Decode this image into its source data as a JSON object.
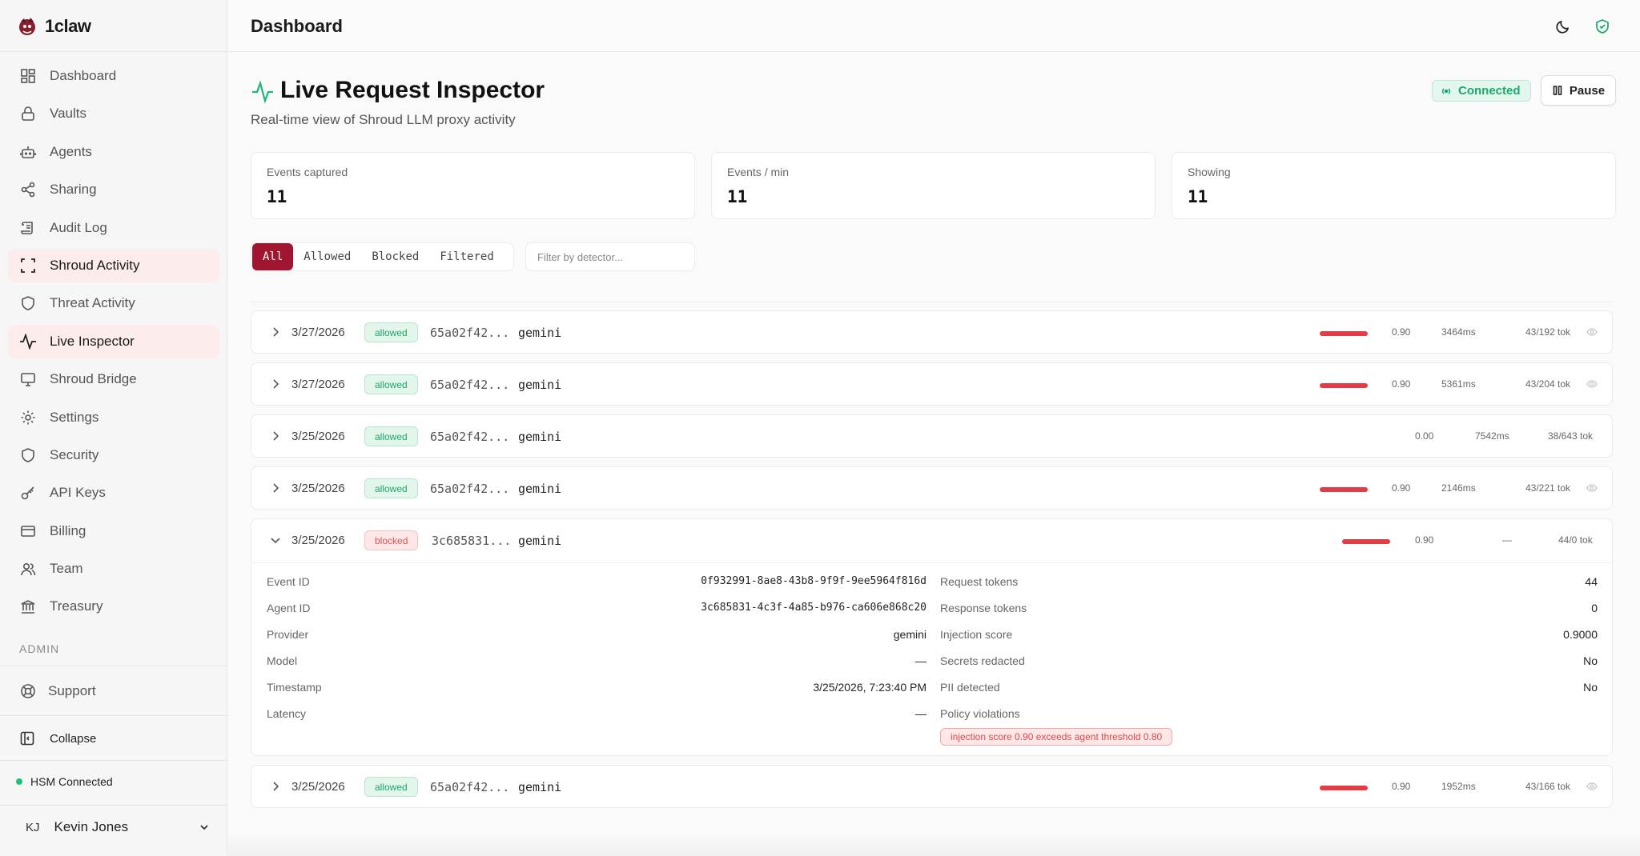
{
  "app": {
    "name": "1claw"
  },
  "sidebar": {
    "items": [
      {
        "label": "Dashboard",
        "icon": "dashboard-icon"
      },
      {
        "label": "Vaults",
        "icon": "lock-icon"
      },
      {
        "label": "Agents",
        "icon": "bot-icon"
      },
      {
        "label": "Sharing",
        "icon": "share-icon"
      },
      {
        "label": "Audit Log",
        "icon": "scroll-icon"
      },
      {
        "label": "Shroud Activity",
        "icon": "scan-icon",
        "active": true
      },
      {
        "label": "Threat Activity",
        "icon": "shield-icon"
      },
      {
        "label": "Live Inspector",
        "icon": "activity-icon",
        "active": true
      },
      {
        "label": "Shroud Bridge",
        "icon": "monitor-icon"
      },
      {
        "label": "Settings",
        "icon": "gear-icon"
      },
      {
        "label": "Security",
        "icon": "shield-icon"
      },
      {
        "label": "API Keys",
        "icon": "key-icon"
      },
      {
        "label": "Billing",
        "icon": "card-icon"
      },
      {
        "label": "Team",
        "icon": "users-icon"
      },
      {
        "label": "Treasury",
        "icon": "bank-icon"
      }
    ],
    "admin_label": "ADMIN",
    "support_label": "Support",
    "collapse_label": "Collapse",
    "hsm_status": "HSM Connected",
    "user": {
      "initials": "KJ",
      "name": "Kevin Jones"
    }
  },
  "topbar": {
    "title": "Dashboard"
  },
  "page": {
    "title": "Live Request Inspector",
    "subtitle": "Real-time view of Shroud LLM proxy activity",
    "connection_status": "Connected",
    "pause_label": "Pause"
  },
  "stats": [
    {
      "label": "Events captured",
      "value": "11"
    },
    {
      "label": "Events / min",
      "value": "11"
    },
    {
      "label": "Showing",
      "value": "11"
    }
  ],
  "filters": {
    "tabs": [
      "All",
      "Allowed",
      "Blocked",
      "Filtered"
    ],
    "active": "All",
    "detector_placeholder": "Filter by detector..."
  },
  "events": [
    {
      "date": "3/27/2026",
      "status": "allowed",
      "agent": "65a02f42...",
      "provider": "gemini",
      "score": "0.90",
      "latency": "3464ms",
      "tokens": "43/192 tok"
    },
    {
      "date": "3/27/2026",
      "status": "allowed",
      "agent": "65a02f42...",
      "provider": "gemini",
      "score": "0.90",
      "latency": "5361ms",
      "tokens": "43/204 tok"
    },
    {
      "date": "3/25/2026",
      "status": "allowed",
      "agent": "65a02f42...",
      "provider": "gemini",
      "score": "0.00",
      "latency": "7542ms",
      "tokens": "38/643 tok"
    },
    {
      "date": "3/25/2026",
      "status": "allowed",
      "agent": "65a02f42...",
      "provider": "gemini",
      "score": "0.90",
      "latency": "2146ms",
      "tokens": "43/221 tok"
    },
    {
      "date": "3/25/2026",
      "status": "blocked",
      "agent": "3c685831...",
      "provider": "gemini",
      "score": "0.90",
      "latency": "—",
      "tokens": "44/0 tok"
    },
    {
      "date": "3/25/2026",
      "status": "allowed",
      "agent": "65a02f42...",
      "provider": "gemini",
      "score": "0.90",
      "latency": "1952ms",
      "tokens": "43/166 tok"
    }
  ],
  "detail": {
    "left": [
      {
        "label": "Event ID",
        "value": "0f932991-8ae8-43b8-9f9f-9ee5964f816d"
      },
      {
        "label": "Agent ID",
        "value": "3c685831-4c3f-4a85-b976-ca606e868c20"
      },
      {
        "label": "Provider",
        "value": "gemini"
      },
      {
        "label": "Model",
        "value": "—"
      },
      {
        "label": "Timestamp",
        "value": "3/25/2026, 7:23:40 PM"
      },
      {
        "label": "Latency",
        "value": "—"
      }
    ],
    "right": [
      {
        "label": "Request tokens",
        "value": "44"
      },
      {
        "label": "Response tokens",
        "value": "0"
      },
      {
        "label": "Injection score",
        "value": "0.9000"
      },
      {
        "label": "Secrets redacted",
        "value": "No"
      },
      {
        "label": "PII detected",
        "value": "No"
      },
      {
        "label": "Policy violations",
        "value": ""
      }
    ],
    "violation": "injection score 0.90 exceeds agent threshold 0.80"
  },
  "colors": {
    "accent": "#a01530",
    "success": "#1ba86a",
    "danger": "#e53943"
  }
}
